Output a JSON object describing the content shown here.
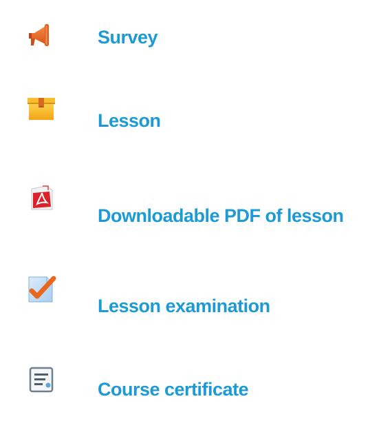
{
  "accent_color": "#1b9ad6",
  "items": [
    {
      "label": "Survey",
      "icon": "megaphone-icon"
    },
    {
      "label": "Lesson",
      "icon": "package-icon"
    },
    {
      "label": "Downloadable PDF of lesson",
      "icon": "pdf-icon"
    },
    {
      "label": "Lesson examination",
      "icon": "checkmark-quiz-icon"
    },
    {
      "label": "Course certificate",
      "icon": "certificate-document-icon"
    }
  ]
}
